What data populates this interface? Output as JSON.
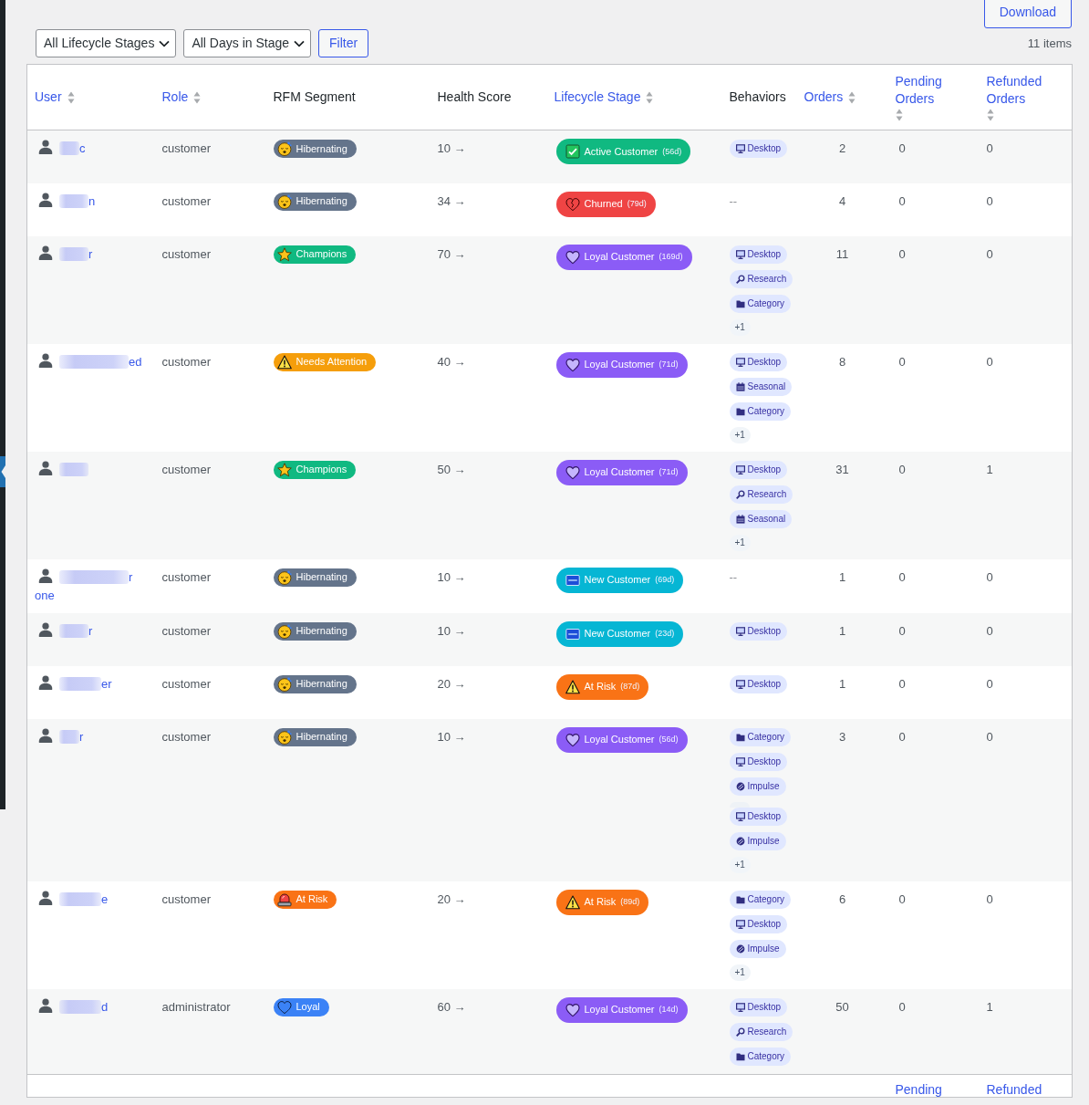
{
  "toolbar": {
    "download_button": "Download",
    "filters": [
      "All Lifecycle Stages",
      "All Days in Stage"
    ],
    "filter_button": "Filter",
    "item_count": "11 items"
  },
  "table": {
    "columns": [
      {
        "label": "User",
        "sortable": true
      },
      {
        "label": "Role",
        "sortable": true
      },
      {
        "label": "RFM Segment",
        "sortable": false
      },
      {
        "label": "Health Score",
        "sortable": false
      },
      {
        "label": "Lifecycle Stage",
        "sortable": true
      },
      {
        "label": "Behaviors",
        "sortable": false
      },
      {
        "label": "Orders",
        "sortable": true
      },
      {
        "label": "Pending Orders",
        "sortable": true
      },
      {
        "label": "Refunded Orders",
        "sortable": true
      }
    ],
    "rows": [
      {
        "user": {
          "name": "c",
          "kind": "short"
        },
        "role": "customer",
        "segment": {
          "label": "Hibernating",
          "kind": "sleep",
          "color": "#64748b"
        },
        "health": "10 →",
        "stage": {
          "label": "Active Customer",
          "days": "(56d)",
          "kind": "check",
          "color": "#10b981"
        },
        "behaviors": [
          {
            "label": "Desktop",
            "kind": "monitor"
          }
        ],
        "orders": "2",
        "pending_orders": "0",
        "refunded_orders": "0"
      },
      {
        "user": {
          "name": "n",
          "kind": "medium"
        },
        "role": "customer",
        "segment": {
          "label": "Hibernating",
          "kind": "sleep",
          "color": "#64748b"
        },
        "health": "34 →",
        "stage": {
          "label": "Churned",
          "days": "(79d)",
          "kind": "broken",
          "color": "#ef4444"
        },
        "behaviors_text": "--",
        "orders": "4",
        "pending_orders": "0",
        "refunded_orders": "0"
      },
      {
        "user": {
          "name": "r",
          "kind": "medium"
        },
        "role": "customer",
        "segment": {
          "label": "Champions",
          "kind": "star",
          "color": "#10b981"
        },
        "health": "70 →",
        "stage": {
          "label": "Loyal Customer",
          "days": "(169d)",
          "kind": "heart",
          "color": "#8b5cf6"
        },
        "behaviors": [
          {
            "label": "Desktop",
            "kind": "monitor"
          },
          {
            "label": "Research",
            "kind": "search"
          },
          {
            "label": "Category",
            "kind": "folder"
          },
          {
            "label": "+1",
            "kind": "more"
          }
        ],
        "orders": "11",
        "pending_orders": "0",
        "refunded_orders": "0"
      },
      {
        "user": {
          "name": "ed",
          "kind": "long"
        },
        "role": "customer",
        "segment": {
          "label": "Needs Attention",
          "kind": "warning",
          "color": "#f59e0b"
        },
        "health": "40 →",
        "stage": {
          "label": "Loyal Customer",
          "days": "(71d)",
          "kind": "heart",
          "color": "#8b5cf6"
        },
        "behaviors": [
          {
            "label": "Desktop",
            "kind": "monitor"
          },
          {
            "label": "Seasonal",
            "kind": "calendar"
          },
          {
            "label": "Category",
            "kind": "folder"
          },
          {
            "label": "+1",
            "kind": "more"
          }
        ],
        "orders": "8",
        "pending_orders": "0",
        "refunded_orders": "0"
      },
      {
        "user": {
          "kind": "medium"
        },
        "role": "customer",
        "segment": {
          "label": "Champions",
          "kind": "star",
          "color": "#10b981"
        },
        "health": "50 →",
        "stage": {
          "label": "Loyal Customer",
          "days": "(71d)",
          "kind": "heart",
          "color": "#8b5cf6"
        },
        "behaviors": [
          {
            "label": "Desktop",
            "kind": "monitor"
          },
          {
            "label": "Research",
            "kind": "search"
          },
          {
            "label": "Seasonal",
            "kind": "calendar"
          },
          {
            "label": "+1",
            "kind": "more"
          }
        ],
        "orders": "31",
        "pending_orders": "0",
        "refunded_orders": "1"
      },
      {
        "user": {
          "name": "r one",
          "kind": "long"
        },
        "role": "customer",
        "segment": {
          "label": "Hibernating",
          "kind": "sleep",
          "color": "#64748b"
        },
        "health": "10 →",
        "stage": {
          "label": "New Customer",
          "days": "(69d)",
          "kind": "tile",
          "color": "#06b6d4"
        },
        "behaviors_text": "--",
        "orders": "1",
        "pending_orders": "0",
        "refunded_orders": "0"
      },
      {
        "user": {
          "name": "r",
          "kind": "medium"
        },
        "role": "customer",
        "segment": {
          "label": "Hibernating",
          "kind": "sleep",
          "color": "#64748b"
        },
        "health": "10 →",
        "stage": {
          "label": "New Customer",
          "days": "(23d)",
          "kind": "tile",
          "color": "#06b6d4"
        },
        "behaviors": [
          {
            "label": "Desktop",
            "kind": "monitor"
          }
        ],
        "orders": "1",
        "pending_orders": "0",
        "refunded_orders": "0"
      },
      {
        "user": {
          "name": "er",
          "kind": "wide"
        },
        "role": "customer",
        "segment": {
          "label": "Hibernating",
          "kind": "sleep",
          "color": "#64748b"
        },
        "health": "20 →",
        "stage": {
          "label": "At Risk",
          "days": "(87d)",
          "kind": "warning",
          "color": "#f97316"
        },
        "behaviors": [
          {
            "label": "Desktop",
            "kind": "monitor"
          }
        ],
        "orders": "1",
        "pending_orders": "0",
        "refunded_orders": "0"
      },
      {
        "user": {
          "name": "r",
          "kind": "short"
        },
        "role": "customer",
        "segment": {
          "label": "Hibernating",
          "kind": "sleep",
          "color": "#64748b"
        },
        "health": "10 →",
        "stage": {
          "label": "Loyal Customer",
          "days": "(56d)",
          "kind": "heart",
          "color": "#8b5cf6"
        },
        "behaviors": [
          {
            "label": "Category",
            "kind": "folder"
          },
          {
            "label": "Desktop",
            "kind": "monitor"
          },
          {
            "label": "Impulse",
            "kind": "ball"
          },
          {
            "kind": "blank"
          },
          {
            "label": "Desktop",
            "kind": "monitor"
          },
          {
            "label": "Impulse",
            "kind": "ball"
          },
          {
            "label": "+1",
            "kind": "more"
          }
        ],
        "orders": "3",
        "pending_orders": "0",
        "refunded_orders": "0"
      },
      {
        "user": {
          "name": "e",
          "kind": "wide"
        },
        "role": "customer",
        "segment": {
          "label": "At Risk",
          "kind": "siren",
          "color": "#f97316"
        },
        "health": "20 →",
        "stage": {
          "label": "At Risk",
          "days": "(89d)",
          "kind": "warning",
          "color": "#f97316"
        },
        "behaviors": [
          {
            "label": "Category",
            "kind": "folder"
          },
          {
            "label": "Desktop",
            "kind": "monitor"
          },
          {
            "label": "Impulse",
            "kind": "ball"
          },
          {
            "label": "+1",
            "kind": "more"
          }
        ],
        "orders": "6",
        "pending_orders": "0",
        "refunded_orders": "0"
      },
      {
        "user": {
          "name": "d",
          "kind": "wide"
        },
        "role": "administrator",
        "segment": {
          "label": "Loyal",
          "kind": "heart",
          "color": "#3b82f6"
        },
        "health": "60 →",
        "stage": {
          "label": "Loyal Customer",
          "days": "(14d)",
          "kind": "heart",
          "color": "#8b5cf6"
        },
        "behaviors": [
          {
            "label": "Desktop",
            "kind": "monitor"
          },
          {
            "label": "Research",
            "kind": "search"
          },
          {
            "label": "Category",
            "kind": "folder"
          }
        ],
        "orders": "50",
        "pending_orders": "0",
        "refunded_orders": "1"
      }
    ],
    "footer_columns": [
      "Pending",
      "Refunded"
    ]
  }
}
